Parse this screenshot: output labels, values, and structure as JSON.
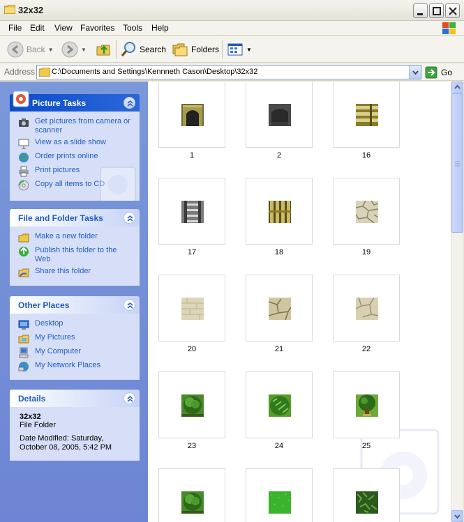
{
  "window": {
    "title": "32x32",
    "icon": "folder-icon"
  },
  "menu": [
    "File",
    "Edit",
    "View",
    "Favorites",
    "Tools",
    "Help"
  ],
  "toolbar": {
    "back_label": "Back",
    "search_label": "Search",
    "folders_label": "Folders"
  },
  "address": {
    "label": "Address",
    "path": "C:\\Documents and Settings\\Kennneth Cason\\Desktop\\32x32",
    "go_label": "Go"
  },
  "picture_tasks": {
    "title": "Picture Tasks",
    "items": [
      {
        "label": "Get pictures from camera or scanner",
        "icon": "camera-icon"
      },
      {
        "label": "View as a slide show",
        "icon": "slideshow-icon"
      },
      {
        "label": "Order prints online",
        "icon": "globe-icon"
      },
      {
        "label": "Print pictures",
        "icon": "printer-icon"
      },
      {
        "label": "Copy all items to CD",
        "icon": "cd-icon"
      }
    ]
  },
  "file_folder_tasks": {
    "title": "File and Folder Tasks",
    "items": [
      {
        "label": "Make a new folder",
        "icon": "new-folder-icon"
      },
      {
        "label": "Publish this folder to the Web",
        "icon": "publish-web-icon"
      },
      {
        "label": "Share this folder",
        "icon": "share-folder-icon"
      }
    ]
  },
  "other_places": {
    "title": "Other Places",
    "items": [
      {
        "label": "Desktop",
        "icon": "desktop-icon"
      },
      {
        "label": "My Pictures",
        "icon": "my-pictures-icon"
      },
      {
        "label": "My Computer",
        "icon": "my-computer-icon"
      },
      {
        "label": "My Network Places",
        "icon": "network-places-icon"
      }
    ]
  },
  "details": {
    "title": "Details",
    "name": "32x32",
    "type": "File Folder",
    "modified": "Date Modified: Saturday, October 08, 2005, 5:42 PM"
  },
  "thumbnails": [
    {
      "label": "1",
      "tile": "arch-gold"
    },
    {
      "label": "2",
      "tile": "arch-dark"
    },
    {
      "label": "16",
      "tile": "bars-horizontal"
    },
    {
      "label": "17",
      "tile": "ladder"
    },
    {
      "label": "18",
      "tile": "bars-vertical"
    },
    {
      "label": "19",
      "tile": "cobblestone"
    },
    {
      "label": "20",
      "tile": "sand-brick"
    },
    {
      "label": "21",
      "tile": "cracked-stone"
    },
    {
      "label": "22",
      "tile": "cracked-stone-light"
    },
    {
      "label": "23",
      "tile": "bush"
    },
    {
      "label": "24",
      "tile": "bush-textured"
    },
    {
      "label": "25",
      "tile": "tree"
    },
    {
      "label": "",
      "tile": "bush"
    },
    {
      "label": "",
      "tile": "grass"
    },
    {
      "label": "",
      "tile": "dark-foliage"
    }
  ],
  "colors": {
    "pane_blue": "#6d85d4",
    "link_blue": "#215dc6",
    "panel_body": "#d6dff7"
  }
}
